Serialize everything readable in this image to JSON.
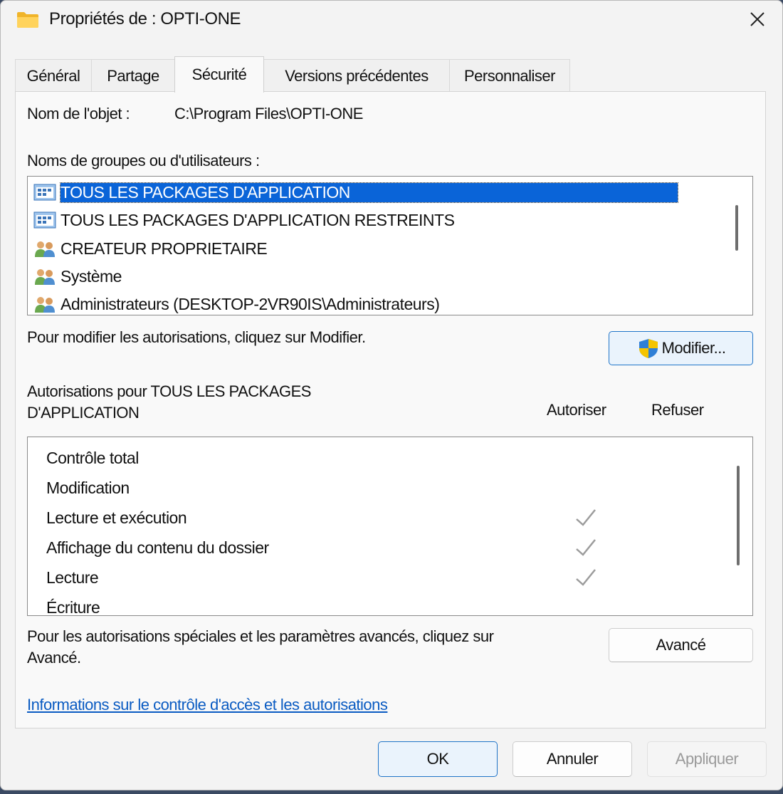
{
  "window": {
    "title": "Propriétés de : OPTI-ONE"
  },
  "tabs": [
    {
      "label": "Général"
    },
    {
      "label": "Partage"
    },
    {
      "label": "Sécurité",
      "active": true
    },
    {
      "label": "Versions précédentes"
    },
    {
      "label": "Personnaliser"
    }
  ],
  "object": {
    "label": "Nom de l'objet :",
    "value": "C:\\Program Files\\OPTI-ONE"
  },
  "groups": {
    "label": "Noms de groupes ou d'utilisateurs :",
    "items": [
      {
        "name": "TOUS LES PACKAGES D'APPLICATION",
        "icon": "app-package-icon",
        "selected": true
      },
      {
        "name": "TOUS LES PACKAGES D'APPLICATION RESTREINTS",
        "icon": "app-package-icon"
      },
      {
        "name": "CREATEUR PROPRIETAIRE",
        "icon": "users-icon"
      },
      {
        "name": "Système",
        "icon": "users-icon"
      },
      {
        "name": "Administrateurs (DESKTOP-2VR90IS\\Administrateurs)",
        "icon": "users-icon"
      }
    ]
  },
  "modify": {
    "hint": "Pour modifier les autorisations, cliquez sur Modifier.",
    "button_label": "Modifier..."
  },
  "permissions": {
    "title_line1": "Autorisations pour TOUS LES PACKAGES",
    "title_line2": "D'APPLICATION",
    "allow_header": "Autoriser",
    "deny_header": "Refuser",
    "rows": [
      {
        "name": "Contrôle total",
        "allow": false,
        "deny": false
      },
      {
        "name": "Modification",
        "allow": false,
        "deny": false
      },
      {
        "name": "Lecture et exécution",
        "allow": true,
        "deny": false
      },
      {
        "name": "Affichage du contenu du dossier",
        "allow": true,
        "deny": false
      },
      {
        "name": "Lecture",
        "allow": true,
        "deny": false
      },
      {
        "name": "Écriture",
        "allow": false,
        "deny": false
      }
    ]
  },
  "advanced": {
    "hint_line1": "Pour les autorisations spéciales et les paramètres avancés, cliquez sur",
    "hint_line2": "Avancé.",
    "button_label": "Avancé"
  },
  "info_link": "Informations sur le contrôle d'accès et les autorisations",
  "footer": {
    "ok_label": "OK",
    "cancel_label": "Annuler",
    "apply_label": "Appliquer"
  },
  "colors": {
    "selection": "#0a64d8",
    "link": "#0a5bc2",
    "accent_border": "#1f74c8"
  }
}
